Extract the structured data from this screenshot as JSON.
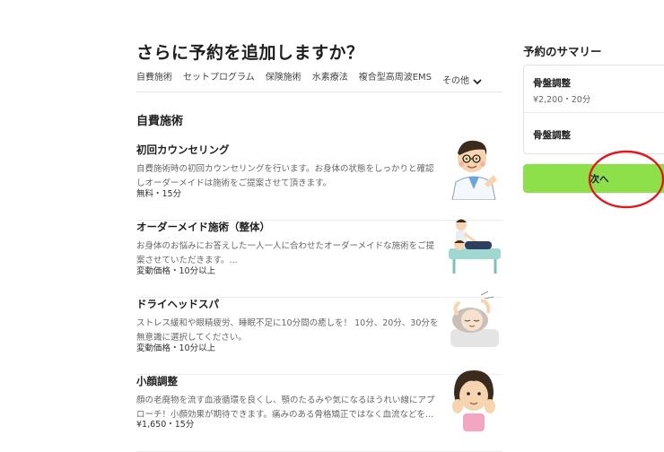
{
  "page": {
    "title": "さらに予約を追加しますか？"
  },
  "tabs": [
    "自費施術",
    "セットプログラム",
    "保険施術",
    "水素療法",
    "複合型高周波EMS",
    "その他"
  ],
  "section": {
    "title": "自費施術"
  },
  "services": [
    {
      "name": "初回カウンセリング",
      "desc": "自費施術時の初回カウンセリングを行います。お身体の状態をしっかりと確認しオーダーメイドは施術をご提案させて頂きます。",
      "meta": "無料・15分",
      "image": "doctor-illustration"
    },
    {
      "name": "オーダーメイド施術（整体）",
      "desc": "お身体のお悩みにお答えした一人一人に合わせたオーダーメイドな施術をご提案させていただきます。...",
      "meta": "変動価格・10分以上",
      "image": "massage-illustration"
    },
    {
      "name": "ドライヘッドスパ",
      "desc": "ストレス緩和や眼精疲労、睡眠不足に10分間の癒しを！ 10分、20分、30分を無意識に選択してください。",
      "meta": "変動価格・10分以上",
      "image": "head-spa-illustration"
    },
    {
      "name": "小顔調整",
      "desc": "顔の老廃物を流す血液循環を良くし、顎のたるみや気になるほうれい線にアプローチ！小顔効果が期待できます。痛みのある骨格矯正ではなく血流などを...",
      "meta": "¥1,650・15分",
      "image": "face-girl-illustration"
    }
  ],
  "summary": {
    "title": "予約のサマリー",
    "items": [
      {
        "name": "骨盤調整",
        "meta": "¥2,200・20分"
      },
      {
        "name": "骨盤調整",
        "meta": ""
      }
    ]
  },
  "next_button": {
    "label": "次へ",
    "color": "#8ee04a"
  },
  "annotation": {
    "color": "#e0191e"
  }
}
